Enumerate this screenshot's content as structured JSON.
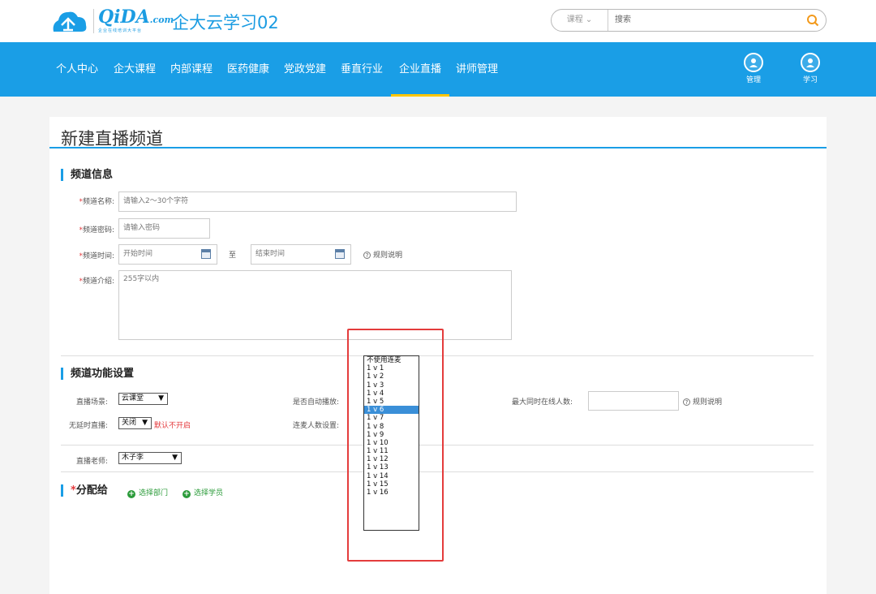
{
  "header": {
    "brand": "QiDA",
    "brand_suffix": ".com",
    "brand_tagline": "企业在线培训大平台",
    "site_title": "企大云学习02",
    "search": {
      "category": "课程",
      "placeholder": "搜索"
    }
  },
  "nav": {
    "items": [
      "个人中心",
      "企大课程",
      "内部课程",
      "医药健康",
      "党政党建",
      "垂直行业",
      "企业直播",
      "讲师管理"
    ],
    "active": "企业直播",
    "buttons": [
      {
        "label": "管理",
        "icon": "admin-icon"
      },
      {
        "label": "学习",
        "icon": "user-icon"
      }
    ]
  },
  "page": {
    "title": "新建直播频道",
    "channel_info": {
      "heading": "频道信息",
      "name_label": "频道名称:",
      "name_placeholder": "请输入2～30个字符",
      "password_label": "频道密码:",
      "password_placeholder": "请输入密码",
      "time_label": "频道时间:",
      "start_placeholder": "开始时间",
      "to_text": "至",
      "end_placeholder": "结束时间",
      "rule_link": "规则说明",
      "intro_label": "频道介绍:",
      "intro_placeholder": "255字以内"
    },
    "features": {
      "heading": "频道功能设置",
      "scene_label": "直播场景:",
      "scene_value": "云课堂",
      "autoplay_label": "是否自动播放:",
      "max_online_label": "最大同时在线人数:",
      "max_online_value": "",
      "rule_link": "规则说明",
      "nodelay_label": "无延时直播:",
      "nodelay_value": "关闭",
      "nodelay_note": "默认不开启",
      "mic_count_label": "连麦人数设置:",
      "teacher_label": "直播老师:",
      "teacher_value": "木子李"
    },
    "assign": {
      "required_mark": "*",
      "heading": "分配给",
      "select_dept": "选择部门",
      "select_member": "选择学员"
    }
  },
  "mic_dropdown": {
    "selected": "1 v 6",
    "options": [
      "不使用连麦",
      "1 v 1",
      "1 v 2",
      "1 v 3",
      "1 v 4",
      "1 v 5",
      "1 v 6",
      "1 v 7",
      "1 v 8",
      "1 v 9",
      "1 v 10",
      "1 v 11",
      "1 v 12",
      "1 v 13",
      "1 v 14",
      "1 v 15",
      "1 v 16"
    ]
  },
  "colors": {
    "primary": "#1a9ee6",
    "active_underline": "#ffc600",
    "required": "#e4393c",
    "highlight_box": "#e43c3c",
    "selected_option": "#3a8fd8"
  }
}
